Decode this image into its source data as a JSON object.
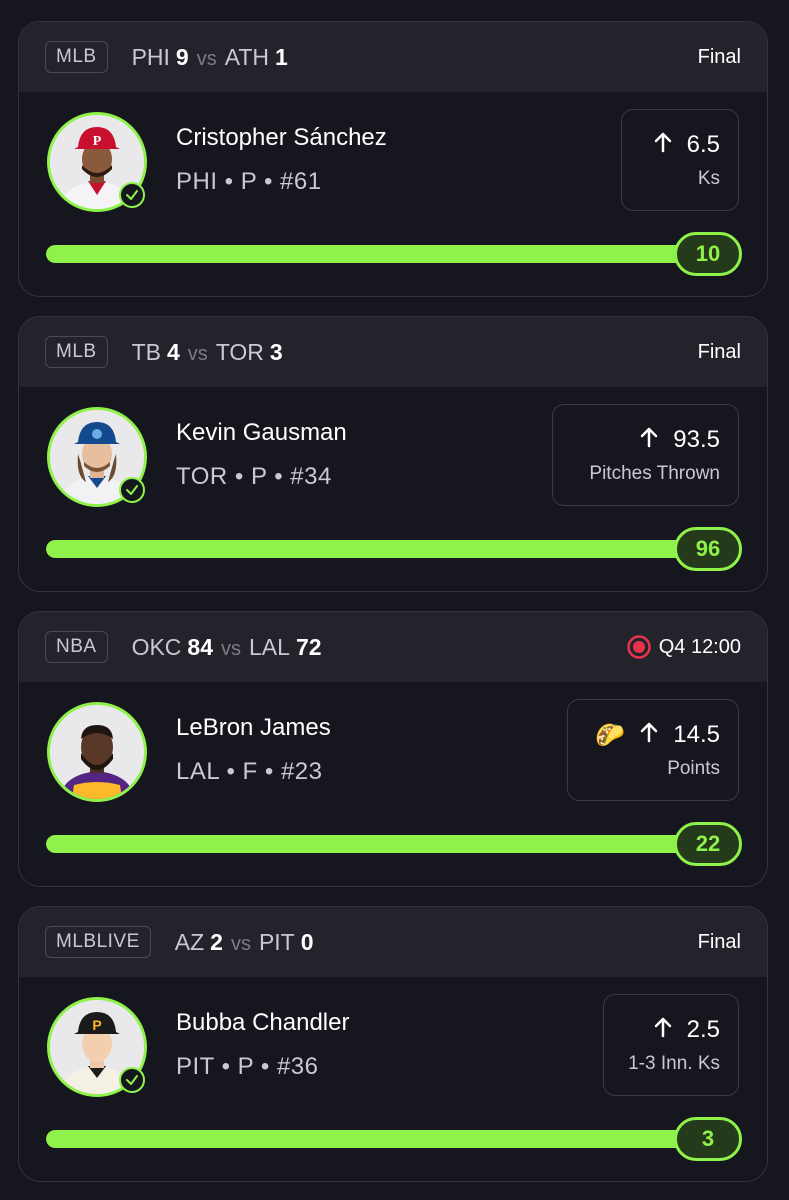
{
  "cards": [
    {
      "league": "MLB",
      "away_team": "PHI",
      "away_score": "9",
      "vs": "vs",
      "home_team": "ATH",
      "home_score": "1",
      "status": "Final",
      "player_name": "Cristopher Sánchez",
      "player_info": "PHI • P • #61",
      "line": "6.5",
      "stat": "Ks",
      "result": "10",
      "progress": 1.0,
      "avatar_icon": "player-headshot-phillies"
    },
    {
      "league": "MLB",
      "away_team": "TB",
      "away_score": "4",
      "vs": "vs",
      "home_team": "TOR",
      "home_score": "3",
      "status": "Final",
      "player_name": "Kevin Gausman",
      "player_info": "TOR • P • #34",
      "line": "93.5",
      "stat": "Pitches Thrown",
      "result": "96",
      "progress": 1.0,
      "avatar_icon": "player-headshot-bluejays"
    },
    {
      "league": "NBA",
      "away_team": "OKC",
      "away_score": "84",
      "vs": "vs",
      "home_team": "LAL",
      "home_score": "72",
      "status": "Q4 12:00",
      "player_name": "LeBron James",
      "player_info": "LAL • F • #23",
      "line": "14.5",
      "stat": "Points",
      "result": "22",
      "progress": 1.0,
      "avatar_icon": "player-headshot-lakers"
    },
    {
      "league": "MLBLIVE",
      "away_team": "AZ",
      "away_score": "2",
      "vs": "vs",
      "home_team": "PIT",
      "home_score": "0",
      "status": "Final",
      "player_name": "Bubba Chandler",
      "player_info": "PIT • P • #36",
      "line": "2.5",
      "stat": "1-3 Inn. Ks",
      "result": "3",
      "progress": 1.0,
      "avatar_icon": "player-headshot-pirates"
    }
  ],
  "colors": {
    "accent": "#8ef24a",
    "background": "#16161e",
    "header": "#23232c",
    "live": "#e8334a"
  }
}
